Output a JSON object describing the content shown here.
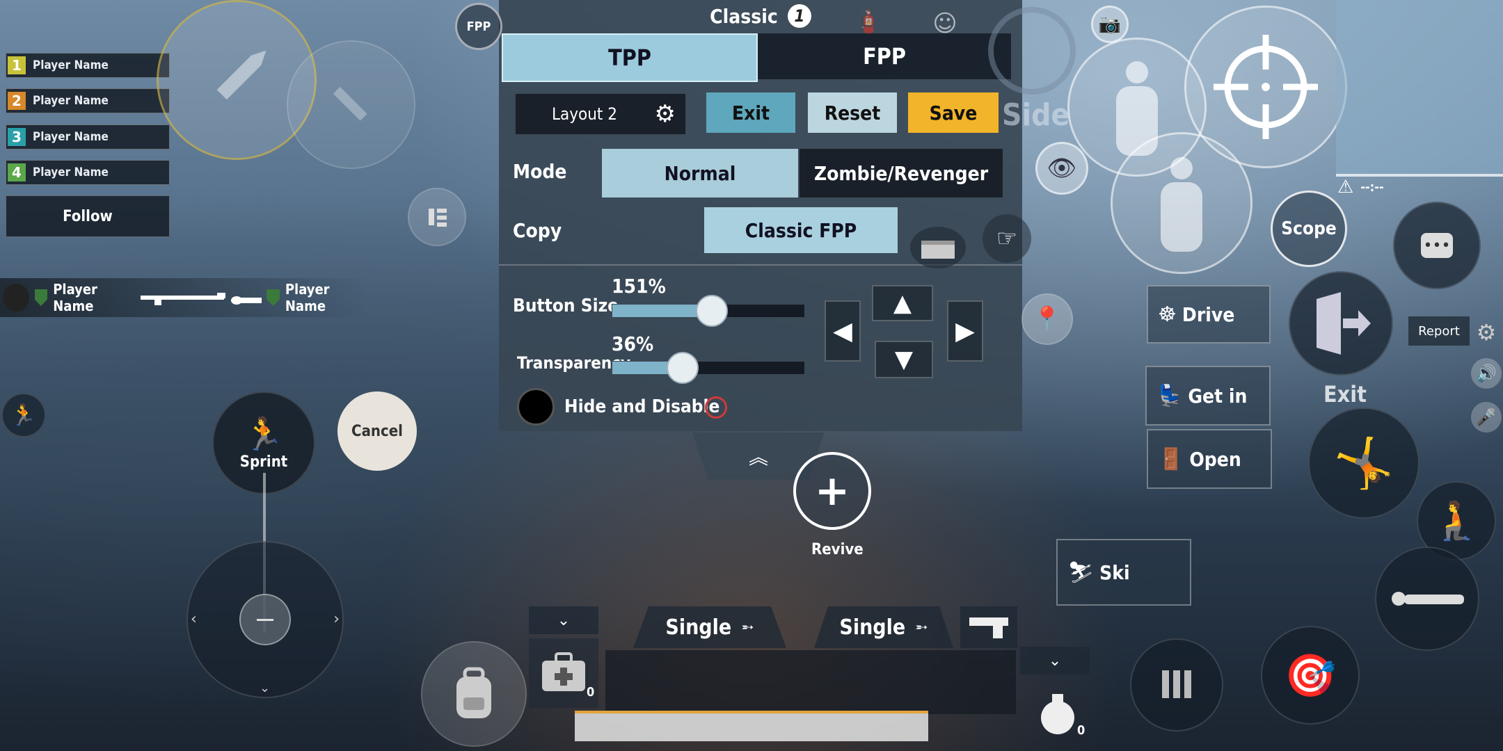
{
  "players": [
    {
      "num": "1",
      "name": "Player Name",
      "color": "#c8c23a"
    },
    {
      "num": "2",
      "name": "Player Name",
      "color": "#d7882a"
    },
    {
      "num": "3",
      "name": "Player Name",
      "color": "#2aa0a8"
    },
    {
      "num": "4",
      "name": "Player Name",
      "color": "#5aa84a"
    }
  ],
  "follow_label": "Follow",
  "killfeed": {
    "killer": "Player Name",
    "victim": "Player Name"
  },
  "fpp_badge": "FPP",
  "header": {
    "mode_title": "Classic",
    "mode_num": "1"
  },
  "tabs": {
    "tpp": "TPP",
    "fpp": "FPP"
  },
  "layout": {
    "name": "Layout 2",
    "exit": "Exit",
    "reset": "Reset",
    "save": "Save"
  },
  "mode": {
    "label": "Mode",
    "normal": "Normal",
    "zombie": "Zombie/Revenger"
  },
  "copy": {
    "label": "Copy",
    "value": "Classic FPP"
  },
  "button_size": {
    "label": "Button Size",
    "value_text": "151%",
    "fraction": 0.51
  },
  "transparency": {
    "label": "Transparency",
    "value_text": "36%",
    "fraction": 0.36
  },
  "hide_disable": "Hide and Disable",
  "side_label": "Side",
  "scope_label": "Scope",
  "report_label": "Report",
  "exit_label": "Exit",
  "actions": {
    "drive": "Drive",
    "get_in": "Get in",
    "open": "Open",
    "ski": "Ski"
  },
  "sprint_label": "Sprint",
  "cancel_label": "Cancel",
  "revive_label": "Revive",
  "weapons": [
    {
      "fire_mode": "Single"
    },
    {
      "fire_mode": "Single"
    }
  ],
  "counts": {
    "medkit": "0",
    "grenade": "0"
  },
  "minimap_readout": "--:--"
}
